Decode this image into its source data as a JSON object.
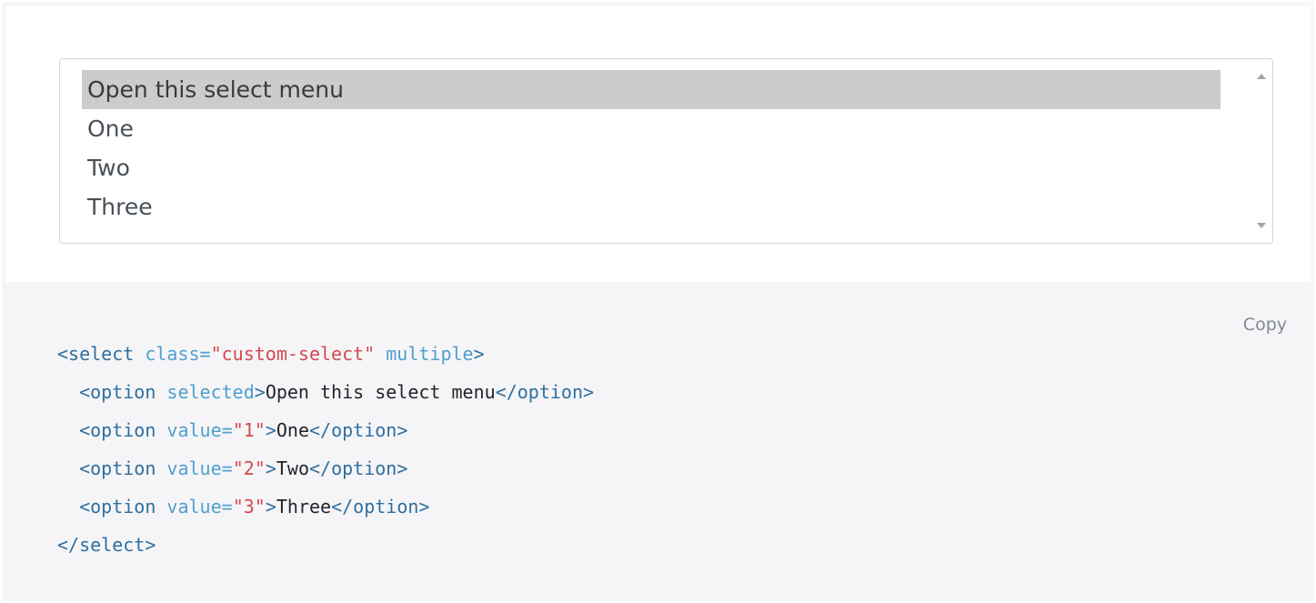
{
  "select": {
    "options": [
      {
        "label": "Open this select menu",
        "selected": true
      },
      {
        "label": "One",
        "selected": false
      },
      {
        "label": "Two",
        "selected": false
      },
      {
        "label": "Three",
        "selected": false
      }
    ]
  },
  "copy_label": "Copy",
  "code": {
    "l1_open": "<select",
    "l1_attr": " class=",
    "l1_str": "\"custom-select\"",
    "l1_attr2": " multiple",
    "l1_close": ">",
    "l2_indent": "  ",
    "l2_open": "<option",
    "l2_attr": " selected",
    "l2_close": ">",
    "l2_text": "Open this select menu",
    "l2_end": "</option>",
    "l3_indent": "  ",
    "l3_open": "<option",
    "l3_attr": " value=",
    "l3_str": "\"1\"",
    "l3_close": ">",
    "l3_text": "One",
    "l3_end": "</option>",
    "l4_indent": "  ",
    "l4_open": "<option",
    "l4_attr": " value=",
    "l4_str": "\"2\"",
    "l4_close": ">",
    "l4_text": "Two",
    "l4_end": "</option>",
    "l5_indent": "  ",
    "l5_open": "<option",
    "l5_attr": " value=",
    "l5_str": "\"3\"",
    "l5_close": ">",
    "l5_text": "Three",
    "l5_end": "</option>",
    "l6_end": "</select>"
  },
  "colors": {
    "selected_option_bg": "#cccccc",
    "code_bg": "#f5f5f7",
    "tag": "#2f6f9f",
    "attr": "#4f9fcf",
    "string": "#d44950"
  }
}
